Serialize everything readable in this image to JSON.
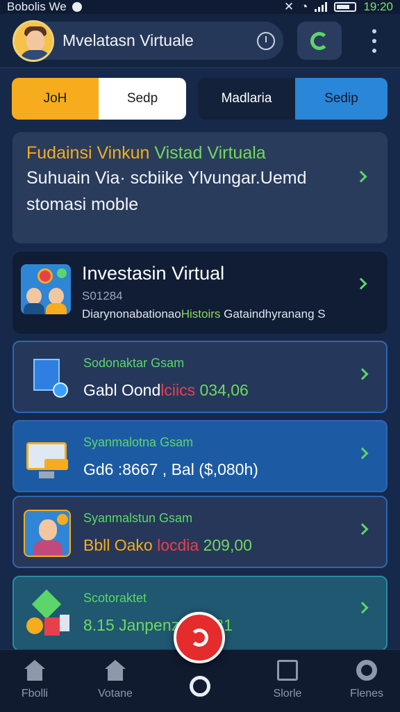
{
  "status_bar": {
    "carrier": "Bobolis We",
    "time": "19:20"
  },
  "header": {
    "title": "Mvelatasn Virtuale"
  },
  "tabs_left": [
    "JoH",
    "Sedp"
  ],
  "tabs_right": [
    "Madlaria",
    "Sedip"
  ],
  "hero": {
    "title_orange": "Fudainsi Vinkun",
    "title_green": "Vistad Virtuala",
    "body": "Suhuain Via· scbiike Ylvungar.Uemd stomasi moble"
  },
  "invest": {
    "title": "Investasin Virtual",
    "subtitle": "S01284",
    "desc_start": "Diarynonabationao",
    "desc_green": "Histoirs",
    "desc_end": " Gataindhyranang S"
  },
  "cards": [
    {
      "label": "Sodonaktar Gsam",
      "value_a": "Gabl Oond",
      "value_b": "lciics",
      "value_c": " 034,06"
    },
    {
      "label": "Syanmalotna Gsam",
      "value_a": "Gd6 :8667",
      "value_b": "",
      "value_c": "  , Bal ($,080h)"
    },
    {
      "label": "Syanmalstun Gsam",
      "value_a": "Bbll Oako",
      "value_b": " locdia",
      "value_c": " 209,00"
    },
    {
      "label": "Scotoraktet",
      "value_a": "8.15 Janpenz",
      "value_b": "",
      "value_c": "  32,081"
    }
  ],
  "bottom_nav": {
    "items": [
      "Fbolli",
      "Votane",
      "Slorle",
      "Flenes"
    ]
  },
  "colors": {
    "accent_orange": "#f6ac1c",
    "accent_green": "#5cd66a",
    "accent_blue": "#2a86d8",
    "fab_red": "#e52b2b"
  }
}
